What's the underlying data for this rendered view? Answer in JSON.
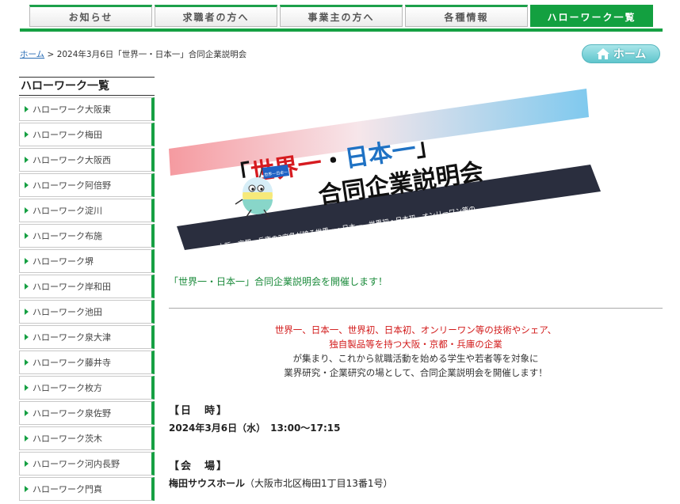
{
  "nav": {
    "tabs": [
      {
        "label": "お知らせ"
      },
      {
        "label": "求職者の方へ"
      },
      {
        "label": "事業主の方へ"
      },
      {
        "label": "各種情報"
      },
      {
        "label": "ハローワーク一覧"
      }
    ],
    "active_index": 4
  },
  "breadcrumb": {
    "home": "ホーム",
    "separator": ">",
    "current": "2024年3月6日「世界一・日本一」合同企業説明会"
  },
  "home_button": {
    "label": "ホーム",
    "icon": "house-icon"
  },
  "sidebar": {
    "title": "ハローワーク一覧",
    "items": [
      {
        "label": "ハローワーク大阪東"
      },
      {
        "label": "ハローワーク梅田"
      },
      {
        "label": "ハローワーク大阪西"
      },
      {
        "label": "ハローワーク阿倍野"
      },
      {
        "label": "ハローワーク淀川"
      },
      {
        "label": "ハローワーク布施"
      },
      {
        "label": "ハローワーク堺"
      },
      {
        "label": "ハローワーク岸和田"
      },
      {
        "label": "ハローワーク池田"
      },
      {
        "label": "ハローワーク泉大津"
      },
      {
        "label": "ハローワーク藤井寺"
      },
      {
        "label": "ハローワーク枚方"
      },
      {
        "label": "ハローワーク泉佐野"
      },
      {
        "label": "ハローワーク茨木"
      },
      {
        "label": "ハローワーク河内長野"
      },
      {
        "label": "ハローワーク門真"
      }
    ]
  },
  "banner": {
    "title_open": "「",
    "title_red": "世界一",
    "title_dot": "・",
    "title_blue": "日本一",
    "title_close": "」",
    "subtitle": "合同企業説明会",
    "mascot_flag": "世界一日本一",
    "tagline_1": "大阪・京都・兵庫の3府県が誇る世界一・日本一、世界初・日本初、オンリーワン等の",
    "tagline_2": "技術やシェア、独自製品等を持つ企業 50社（予定）が集まる業界研究・企業研究イベント"
  },
  "main": {
    "headline": "「世界一・日本一」合同企業説明会を開催します！",
    "intro_red_1": "世界一、日本一、世界初、日本初、オンリーワン等の技術やシェア、",
    "intro_red_2": "独自製品等を持つ大阪・京都・兵庫の企業",
    "intro_3": "が集まり、これから就職活動を始める学生や若者等を対象に",
    "intro_4": "業界研究・企業研究の場として、合同企業説明会を開催します！",
    "datetime_head": "【日　時】",
    "datetime_value": "2024年3月6日（水）　13:00〜17:15",
    "venue_head": "【会　場】",
    "venue_name": "梅田サウスホール",
    "venue_address": "（大阪市北区梅田1丁目13番1号）"
  },
  "colors": {
    "brand_green": "#16a043",
    "link_blue": "#2a6db5",
    "accent_red": "#d21a1a",
    "home_button_teal": "#5fc5cc"
  }
}
